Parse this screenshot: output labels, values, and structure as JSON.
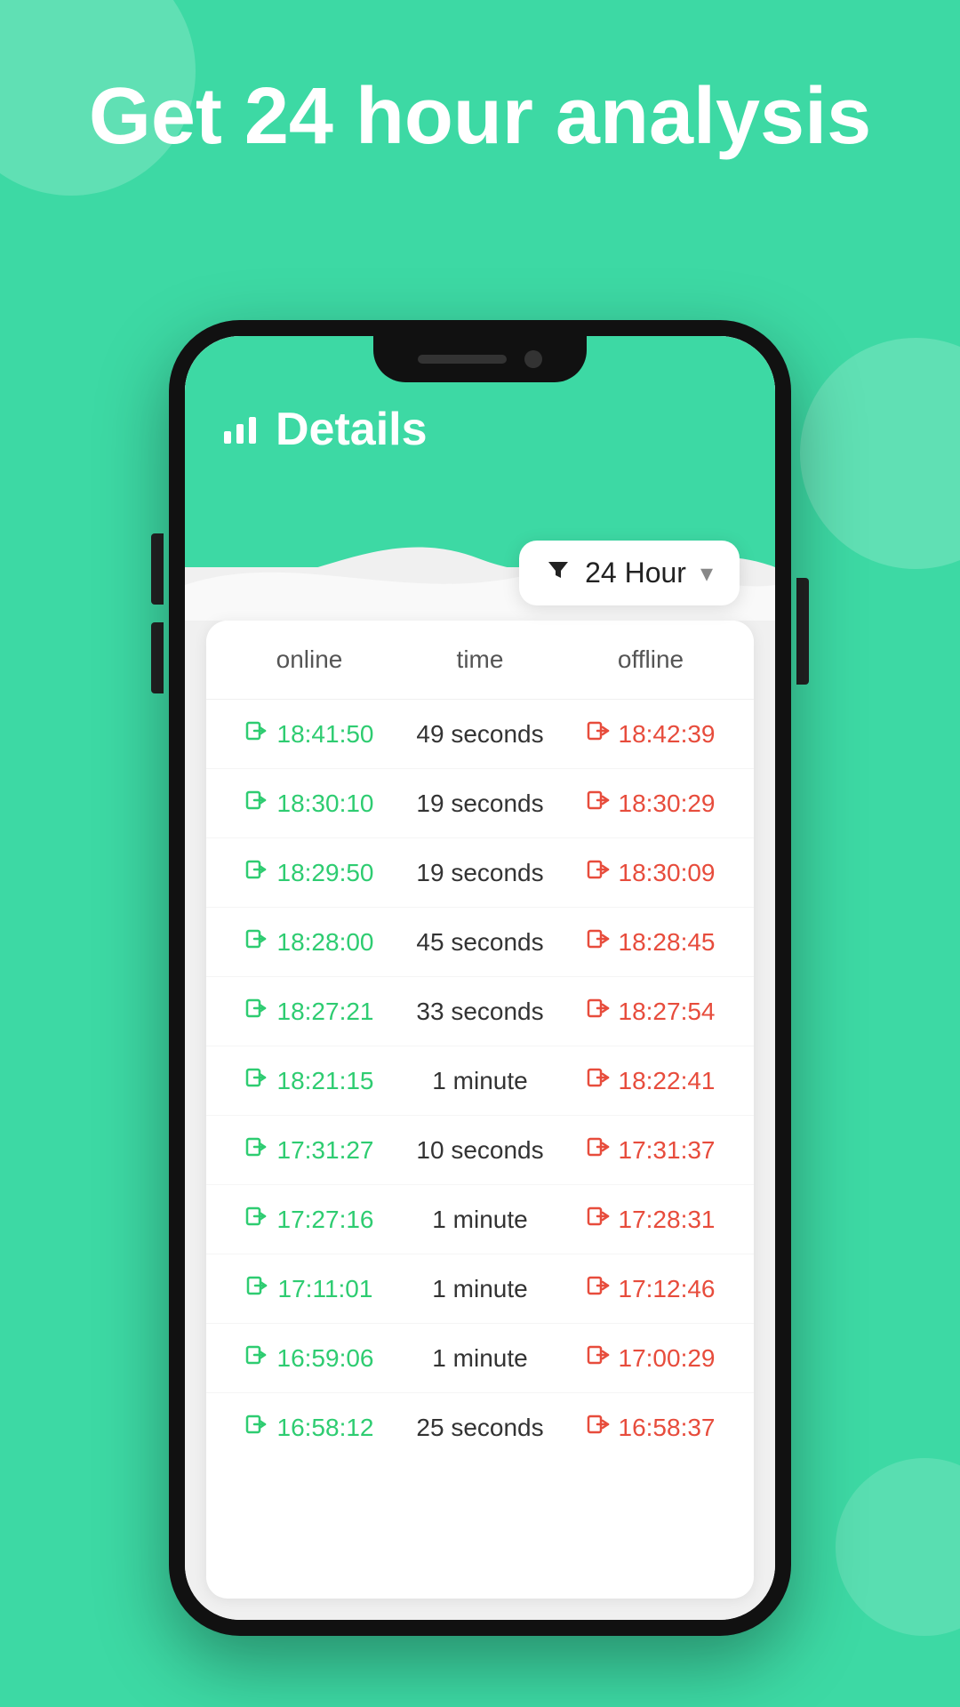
{
  "hero": {
    "title": "Get 24 hour analysis"
  },
  "app": {
    "header_title": "Details",
    "header_icon": "📊"
  },
  "filter": {
    "label": "24 Hour",
    "icon": "▼"
  },
  "table": {
    "columns": {
      "online": "online",
      "time": "time",
      "offline": "offline"
    },
    "rows": [
      {
        "online": "18:41:50",
        "time": "49 seconds",
        "offline": "18:42:39"
      },
      {
        "online": "18:30:10",
        "time": "19 seconds",
        "offline": "18:30:29"
      },
      {
        "online": "18:29:50",
        "time": "19 seconds",
        "offline": "18:30:09"
      },
      {
        "online": "18:28:00",
        "time": "45 seconds",
        "offline": "18:28:45"
      },
      {
        "online": "18:27:21",
        "time": "33 seconds",
        "offline": "18:27:54"
      },
      {
        "online": "18:21:15",
        "time": "1 minute",
        "offline": "18:22:41"
      },
      {
        "online": "17:31:27",
        "time": "10 seconds",
        "offline": "17:31:37"
      },
      {
        "online": "17:27:16",
        "time": "1 minute",
        "offline": "17:28:31"
      },
      {
        "online": "17:11:01",
        "time": "1 minute",
        "offline": "17:12:46"
      },
      {
        "online": "16:59:06",
        "time": "1 minute",
        "offline": "17:00:29"
      },
      {
        "online": "16:58:12",
        "time": "25 seconds",
        "offline": "16:58:37"
      }
    ]
  },
  "colors": {
    "teal": "#3dd9a4",
    "online_green": "#2ecc71",
    "offline_red": "#e74c3c"
  }
}
